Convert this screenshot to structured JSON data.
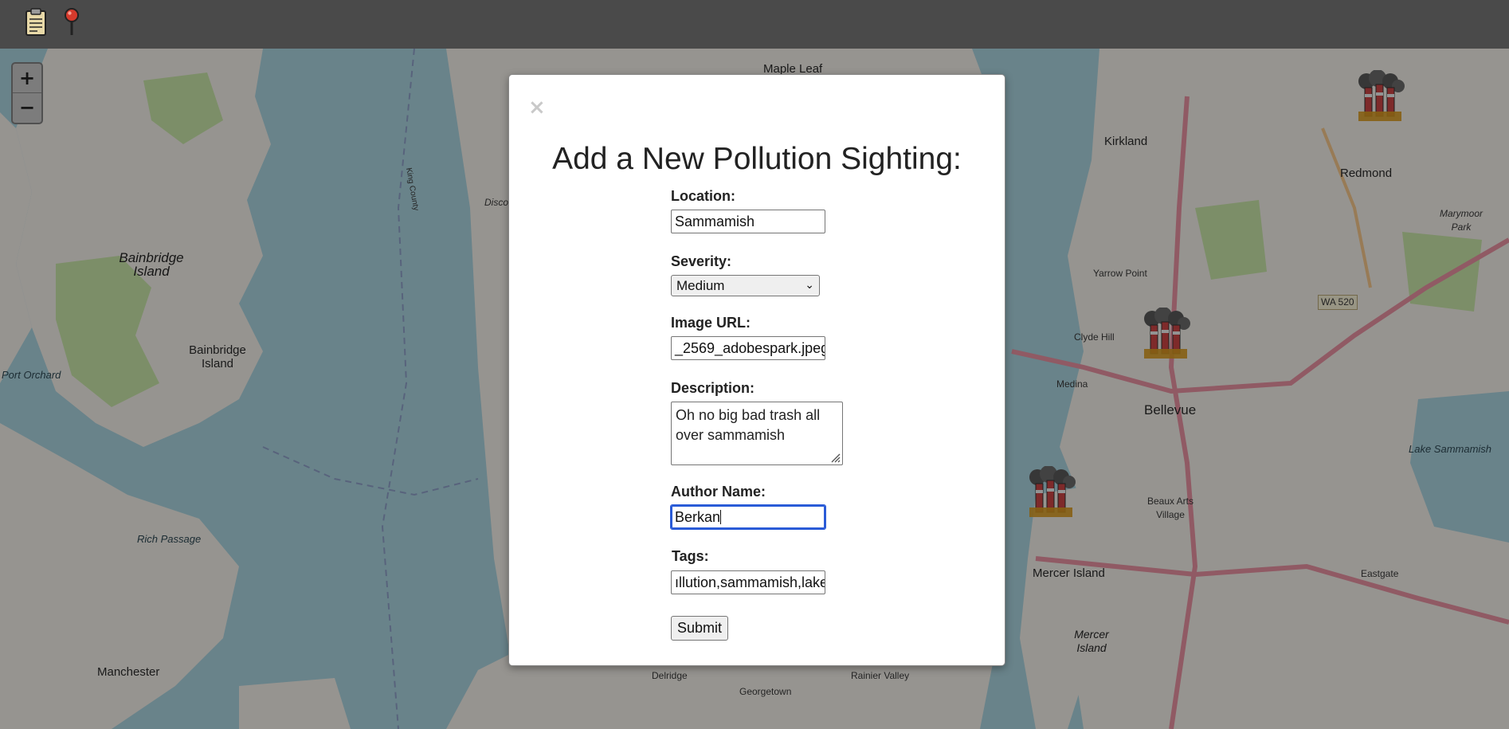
{
  "toolbar": {
    "icons": [
      {
        "name": "clipboard-icon",
        "label": "clipboard"
      },
      {
        "name": "map-pin-icon",
        "label": "pin"
      }
    ]
  },
  "map": {
    "zoom_in": "+",
    "zoom_out": "−",
    "labels": [
      {
        "text": "Maple Leaf",
        "kind": "normal"
      },
      {
        "text": "Kirkland",
        "kind": "normal"
      },
      {
        "text": "Redmond",
        "kind": "normal"
      },
      {
        "text": "Bainbridge Island",
        "kind": "big"
      },
      {
        "text": "Bainbridge Island",
        "kind": "normal"
      },
      {
        "text": "Yarrow Point",
        "kind": "small"
      },
      {
        "text": "Clyde Hill",
        "kind": "small"
      },
      {
        "text": "Medina",
        "kind": "small"
      },
      {
        "text": "Bellevue",
        "kind": "normal"
      },
      {
        "text": "Port Orchard",
        "kind": "water"
      },
      {
        "text": "Rich Passage",
        "kind": "water"
      },
      {
        "text": "Beaux Arts Village",
        "kind": "small"
      },
      {
        "text": "Mercer Island",
        "kind": "normal"
      },
      {
        "text": "Eastgate",
        "kind": "small"
      },
      {
        "text": "Mercer Island",
        "kind": "big"
      },
      {
        "text": "Manchester",
        "kind": "normal"
      },
      {
        "text": "Delridge",
        "kind": "small"
      },
      {
        "text": "Georgetown",
        "kind": "small"
      },
      {
        "text": "Rainier Valley",
        "kind": "small"
      },
      {
        "text": "Lake Sammamish",
        "kind": "water"
      },
      {
        "text": "Marymoor Park",
        "kind": "small"
      },
      {
        "text": "WA 520",
        "kind": "small"
      },
      {
        "text": "King County",
        "kind": "small"
      },
      {
        "text": "Disco",
        "kind": "small"
      }
    ],
    "markers": [
      {
        "name": "pollution-marker-redmond"
      },
      {
        "name": "pollution-marker-bellevue"
      },
      {
        "name": "pollution-marker-mercer"
      }
    ]
  },
  "modal": {
    "close": "×",
    "title": "Add a New Pollution Sighting:",
    "fields": {
      "location": {
        "label": "Location:",
        "value": "Sammamish"
      },
      "severity": {
        "label": "Severity:",
        "value": "Medium"
      },
      "image_url": {
        "label": "Image URL:",
        "value": "_2569_adobespark.jpeg"
      },
      "description": {
        "label": "Description:",
        "value": "Oh no big bad trash all over sammamish"
      },
      "author": {
        "label": "Author Name:",
        "value": "Berkan"
      },
      "tags": {
        "label": "Tags:",
        "value": "ıllution,sammamish,lake"
      }
    },
    "submit": "Submit"
  },
  "colors": {
    "toolbar": "#4a4a4a",
    "water": "#aad3df",
    "land": "#f2efe9",
    "park": "#c8e6a8",
    "highway": "#e892a2",
    "focus": "#2a5bd7"
  }
}
